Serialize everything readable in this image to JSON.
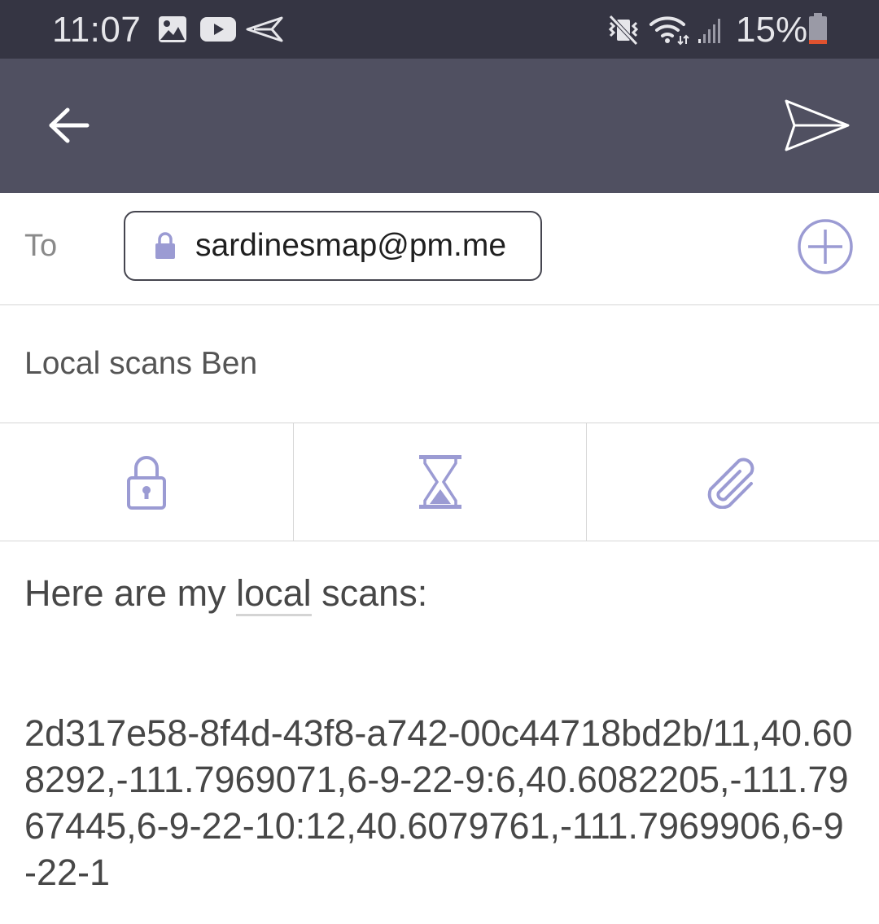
{
  "status_bar": {
    "time": "11:07",
    "battery_percent": "15%",
    "battery_level": 0.15,
    "notification_icons": [
      "gallery-icon",
      "youtube-icon",
      "send-icon"
    ],
    "system_icons": [
      "vibrate-off-icon",
      "wifi-icon",
      "signal-icon",
      "battery-icon"
    ]
  },
  "app_bar": {
    "back_icon": "arrow-left-icon",
    "send_icon": "send-icon"
  },
  "compose": {
    "to_label": "To",
    "recipients": [
      "sardinesmap@pm.me"
    ],
    "subject": "Local scans Ben",
    "options": [
      "lock-icon",
      "hourglass-icon",
      "paperclip-icon"
    ],
    "body_prefix": "Here are my ",
    "body_underlined": "local",
    "body_suffix": " scans:",
    "scan_data": "2d317e58-8f4d-43f8-a742-00c44718bd2b/11,40.608292,-111.7969071,6-9-22-9:6,40.6082205,-111.7967445,6-9-22-10:12,40.6079761,-111.7969906,6-9-22-1"
  },
  "colors": {
    "status_bar": "#353543",
    "app_bar": "#505061",
    "accent": "#9b9bd3",
    "battery_low": "#e0522f"
  }
}
